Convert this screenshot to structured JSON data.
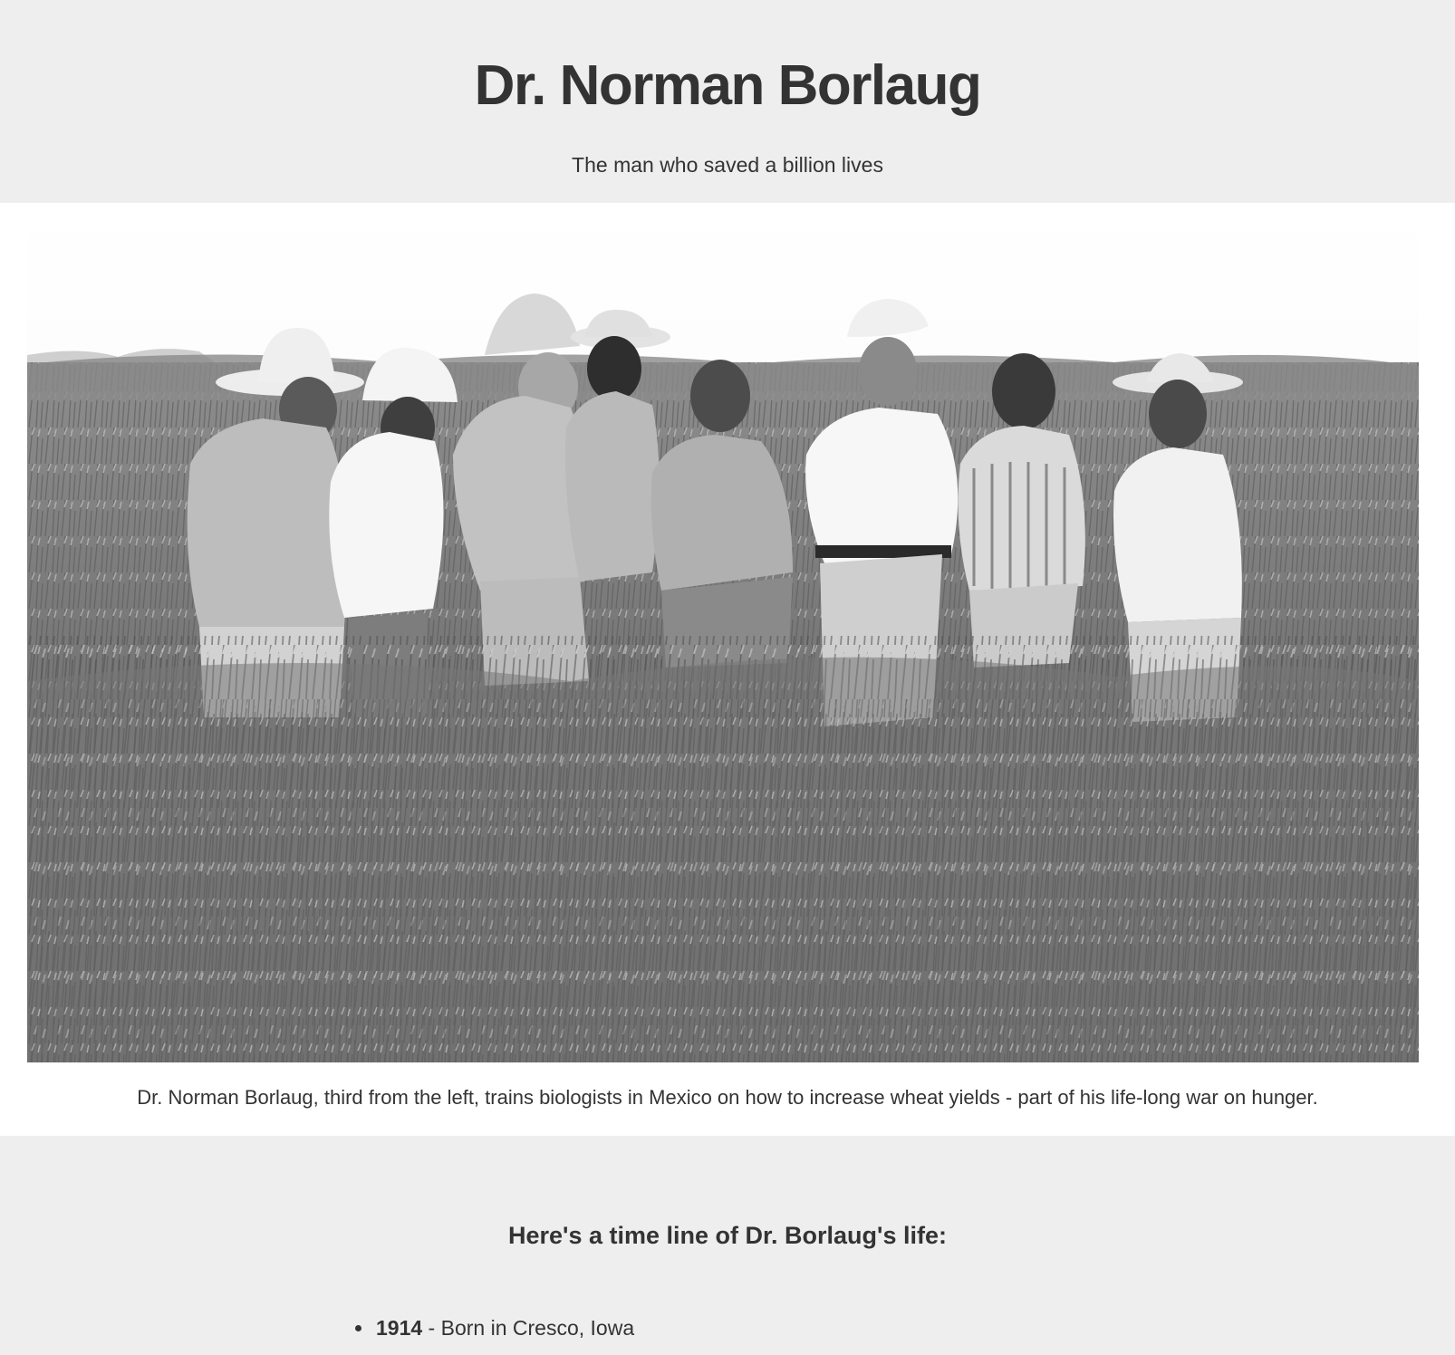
{
  "header": {
    "title": "Dr. Norman Borlaug",
    "subtitle": "The man who saved a billion lives"
  },
  "figure": {
    "caption": "Dr. Norman Borlaug, third from the left, trains biologists in Mexico on how to increase wheat yields - part of his life-long war on hunger."
  },
  "timeline": {
    "heading": "Here's a time line of Dr. Borlaug's life:",
    "items": [
      {
        "year": "1914",
        "separator": " - ",
        "text": "Born in Cresco, Iowa"
      }
    ]
  }
}
